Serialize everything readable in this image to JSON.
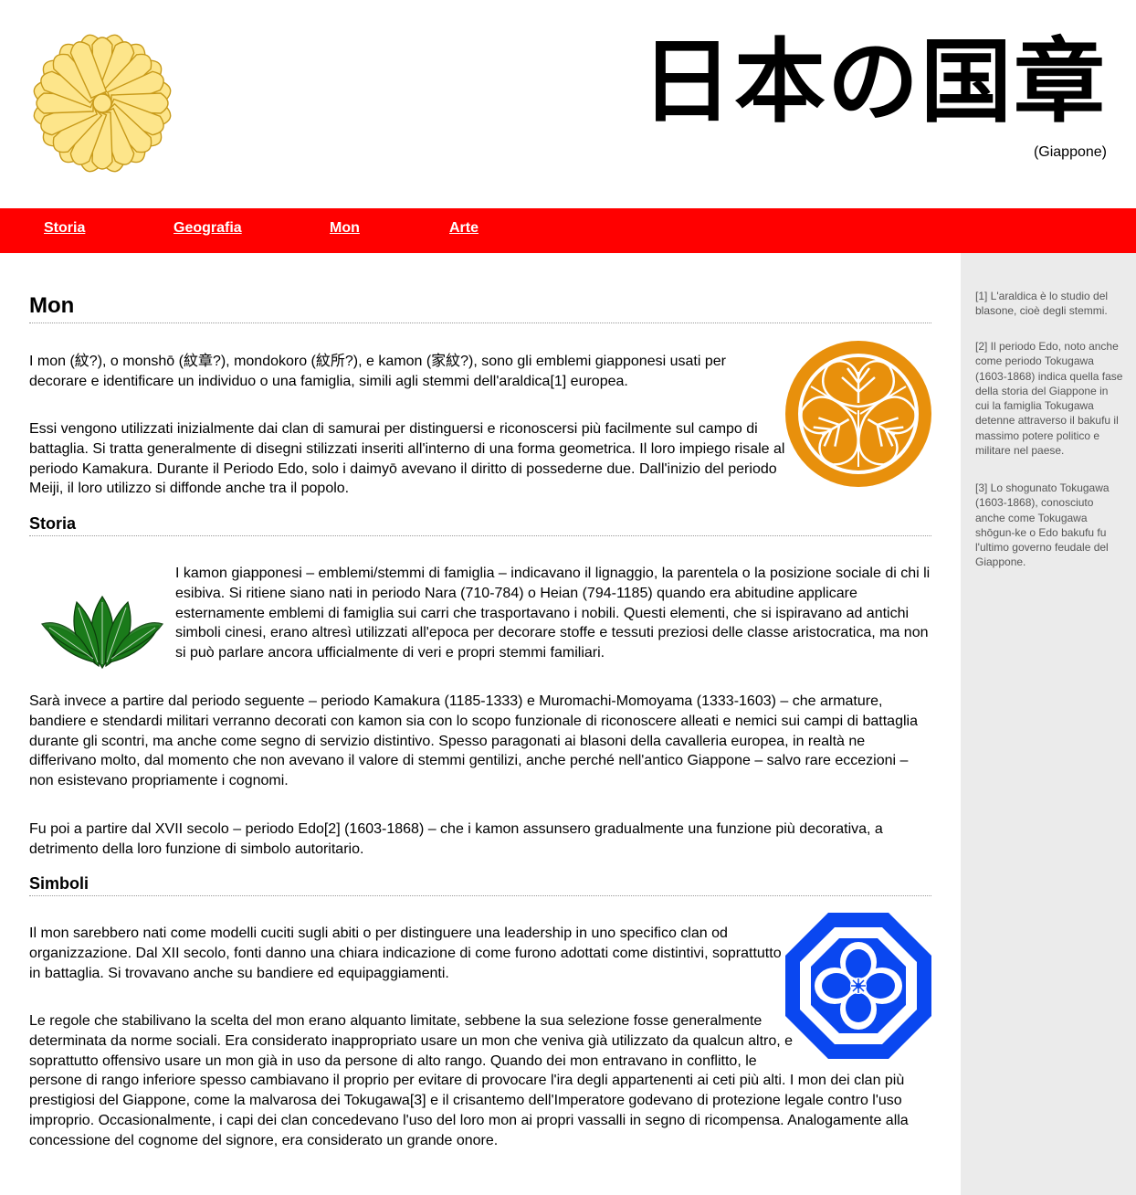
{
  "header": {
    "title_jp": "日本の国章",
    "subtitle": "(Giappone)",
    "logo_icon": "chrysanthemum-seal-icon"
  },
  "nav": {
    "items": [
      {
        "label": "Storia"
      },
      {
        "label": "Geografia"
      },
      {
        "label": "Mon"
      },
      {
        "label": "Arte"
      }
    ],
    "bg_color": "#ff0000"
  },
  "main": {
    "title": "Mon",
    "intro": [
      "I mon (紋?), o monshō (紋章?), mondokoro (紋所?), e kamon (家紋?), sono gli emblemi giapponesi usati per decorare e identificare un individuo o una famiglia, simili agli stemmi dell'araldica[1] europea.",
      "Essi vengono utilizzati inizialmente dai clan di samurai per distinguersi e riconoscersi più facilmente sul campo di battaglia. Si tratta generalmente di disegni stilizzati inseriti all'interno di una forma geometrica. Il loro impiego risale al periodo Kamakura. Durante il Periodo Edo, solo i daimyō avevano il diritto di possederne due. Dall'inizio del periodo Meiji, il loro utilizzo si diffonde anche tra il popolo."
    ],
    "storia": {
      "heading": "Storia",
      "paragraphs": [
        "I kamon giapponesi – emblemi/stemmi di famiglia – indicavano il lignaggio, la parentela o la posizione sociale di chi li esibiva. Si ritiene siano nati in periodo Nara (710-784) o Heian (794-1185) quando era abitudine applicare esternamente emblemi di famiglia sui carri che trasportavano i nobili. Questi elementi, che si ispiravano ad antichi simboli cinesi, erano altresì utilizzati all'epoca per decorare stoffe e tessuti preziosi delle classe aristocratica, ma non si può parlare ancora ufficialmente di veri e propri stemmi familiari.",
        "Sarà invece a partire dal periodo seguente – periodo Kamakura (1185-1333) e Muromachi-Momoyama (1333-1603) – che armature, bandiere e stendardi militari verranno decorati con kamon sia con lo scopo funzionale di riconoscere alleati e nemici sui campi di battaglia durante gli scontri, ma anche come segno di servizio distintivo. Spesso paragonati ai blasoni della cavalleria europea, in realtà ne differivano molto, dal momento che non avevano il valore di stemmi gentilizi, anche perché nell'antico Giappone – salvo rare eccezioni – non esistevano propriamente i cognomi.",
        "Fu poi a partire dal XVII secolo – periodo Edo[2] (1603-1868) – che i kamon assunsero gradualmente una funzione più decorativa, a detrimento della loro funzione di simbolo autoritario."
      ]
    },
    "simboli": {
      "heading": "Simboli",
      "paragraphs": [
        "Il mon sarebbero nati come modelli cuciti sugli abiti o per distinguere una leadership in uno specifico clan od organizzazione. Dal XII secolo, fonti danno una chiara indicazione di come furono adottati come distintivi, soprattutto in battaglia. Si trovavano anche su bandiere ed equipaggiamenti.",
        "Le regole che stabilivano la scelta del mon erano alquanto limitate, sebbene la sua selezione fosse generalmente determinata da norme sociali. Era considerato inappropriato usare un mon che veniva già utilizzato da qualcun altro, e soprattutto offensivo usare un mon già in uso da persone di alto rango. Quando dei mon entravano in conflitto, le persone di rango inferiore spesso cambiavano il proprio per evitare di provocare l'ira degli appartenenti ai ceti più alti. I mon dei clan più prestigiosi del Giappone, come la malvarosa dei Tokugawa[3] e il crisantemo dell'Imperatore godevano di protezione legale contro l'uso improprio. Occasionalmente, i capi dei clan concedevano l'uso del loro mon ai propri vassalli in segno di ricompensa. Analogamente alla concessione del cognome del signore, era considerato un grande onore."
      ]
    },
    "images": {
      "tokugawa": "tokugawa-hollyhock-mon-icon",
      "bamboo": "bamboo-leaves-mon-icon",
      "flower": "octagon-flower-mon-icon"
    }
  },
  "sidebar": {
    "notes": [
      "[1] L'araldica è lo studio del blasone, cioè degli stemmi.",
      "[2] Il periodo Edo, noto anche come periodo Tokugawa (1603-1868) indica quella fase della storia del Giappone in cui la famiglia Tokugawa detenne attraverso il bakufu il massimo potere politico e militare nel paese.",
      "[3] Lo shogunato Tokugawa (1603-1868), conosciuto anche come Tokugawa shōgun-ke o Edo bakufu fu l'ultimo governo feudale del Giappone."
    ]
  }
}
